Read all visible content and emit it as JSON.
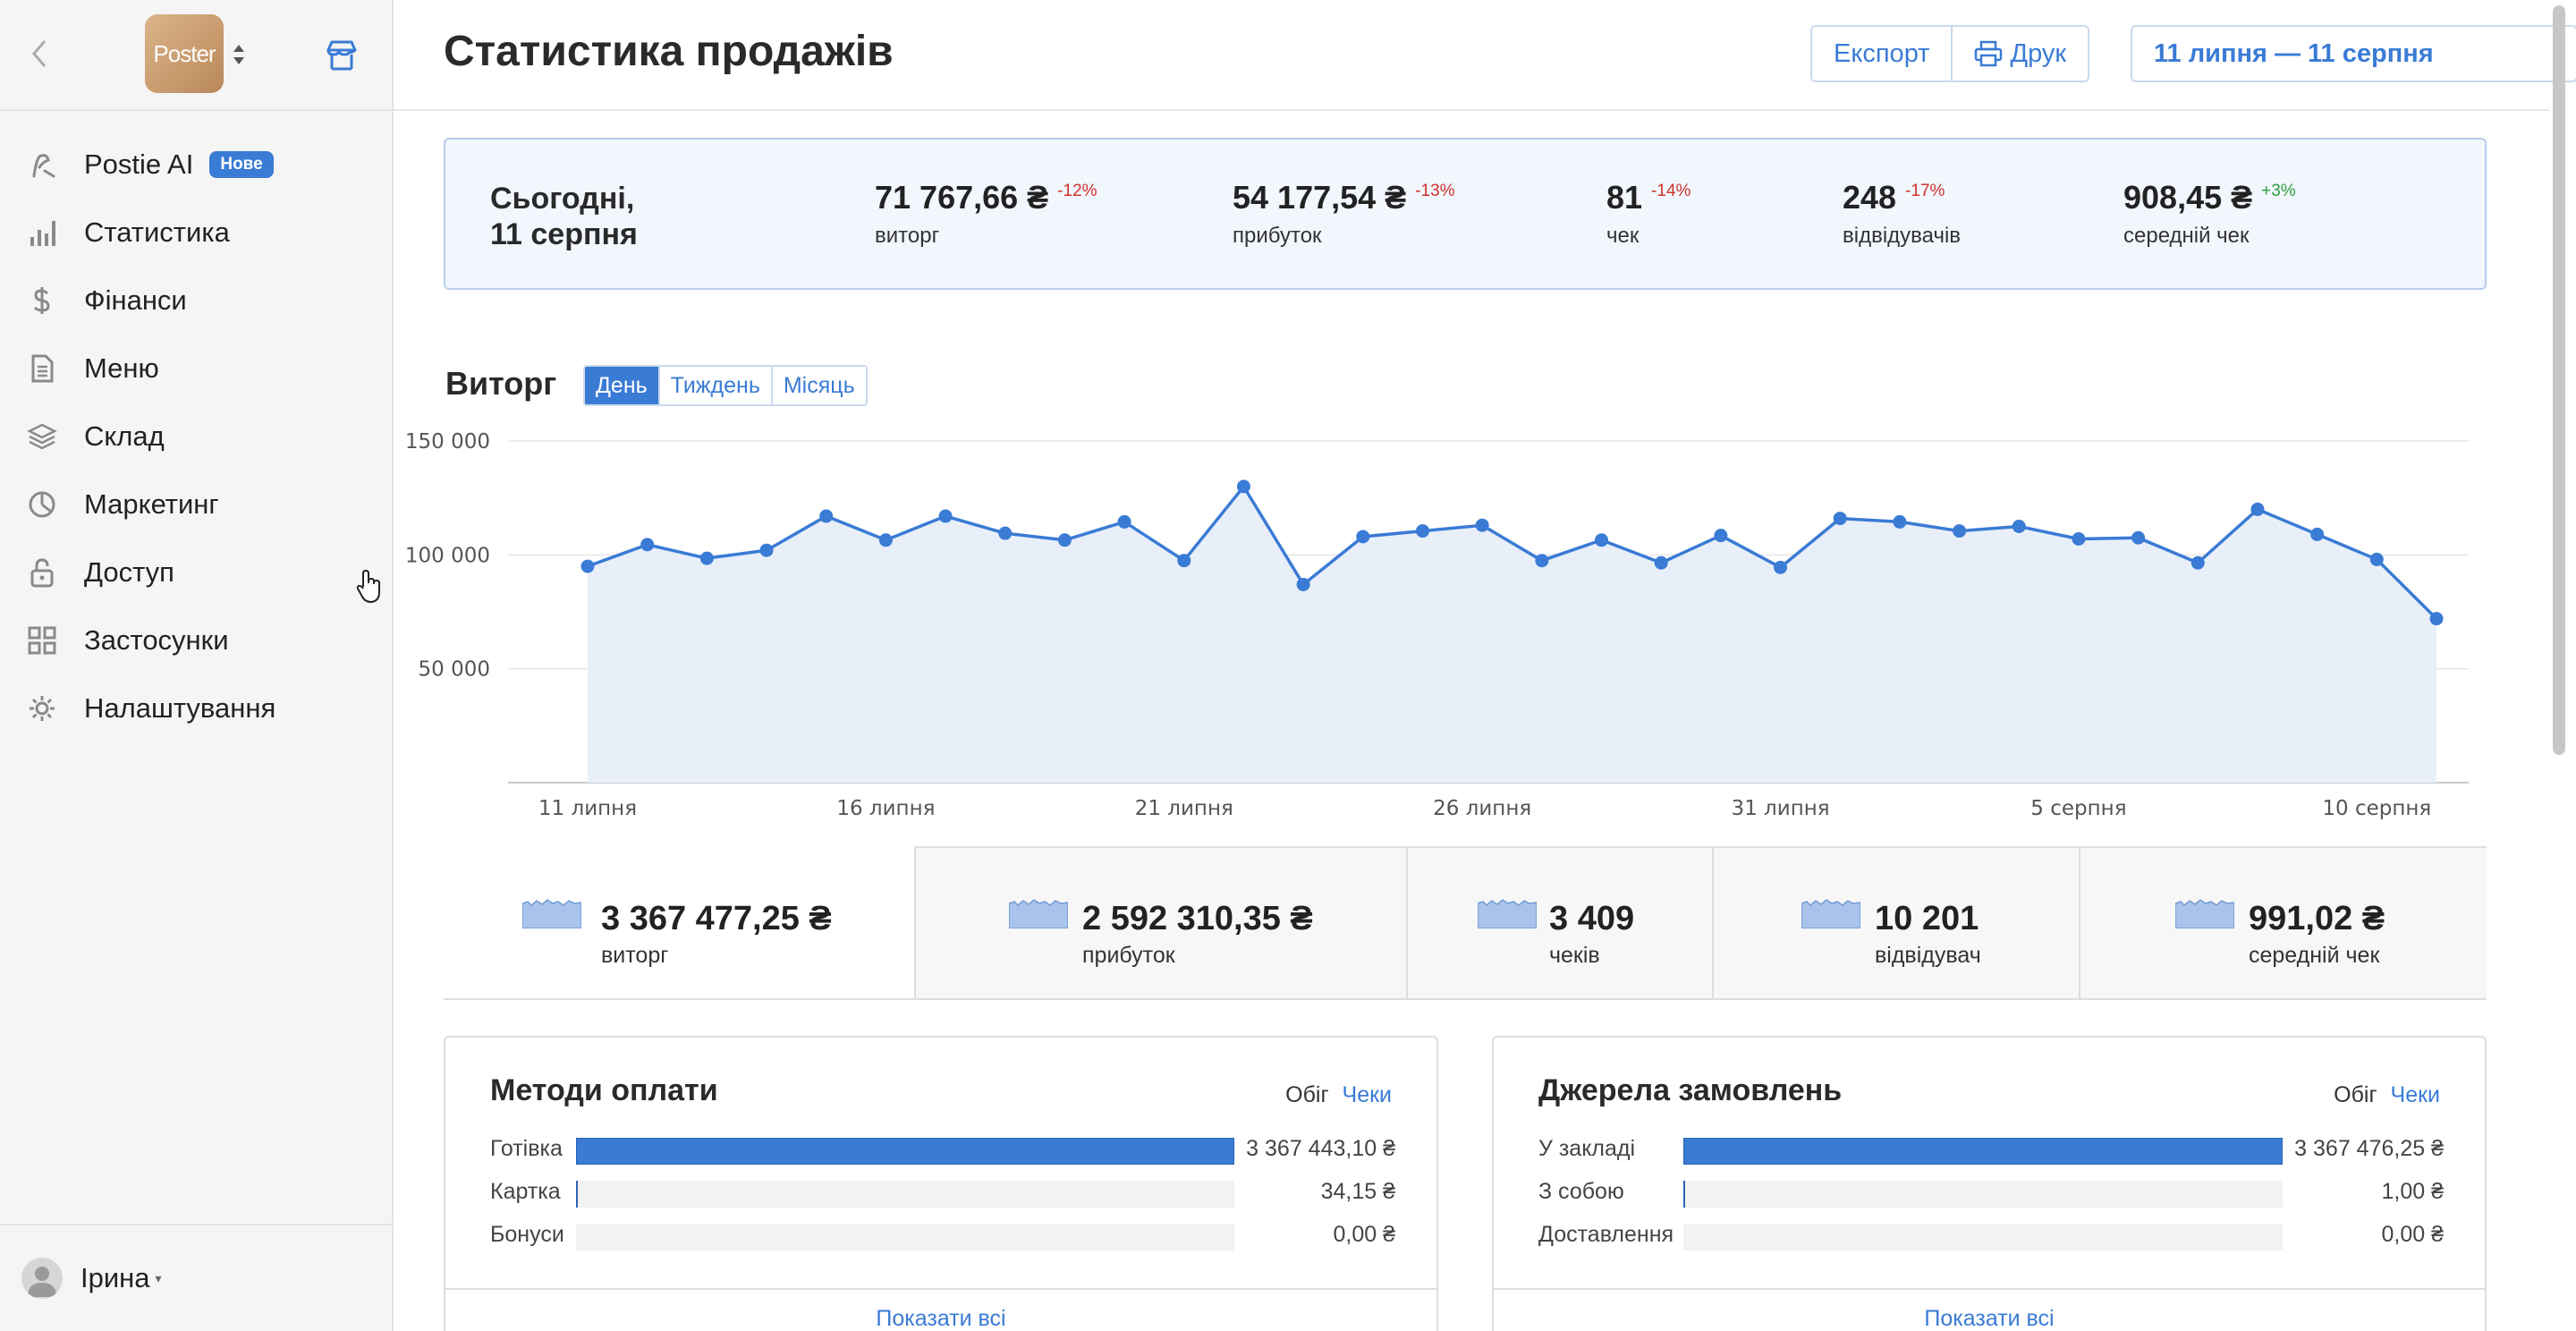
{
  "sidebar": {
    "logo_text": "Poster",
    "items": [
      {
        "label": "Postie AI",
        "icon": "postie-icon",
        "badge": "Нове"
      },
      {
        "label": "Статистика",
        "icon": "bar-chart-icon"
      },
      {
        "label": "Фінанси",
        "icon": "dollar-icon"
      },
      {
        "label": "Меню",
        "icon": "document-icon"
      },
      {
        "label": "Склад",
        "icon": "layers-icon"
      },
      {
        "label": "Маркетинг",
        "icon": "pie-icon"
      },
      {
        "label": "Доступ",
        "icon": "lock-icon"
      },
      {
        "label": "Застосунки",
        "icon": "apps-grid-icon"
      },
      {
        "label": "Налаштування",
        "icon": "gear-icon"
      }
    ],
    "user_name": "Ірина"
  },
  "header": {
    "title": "Статистика продажів",
    "export_label": "Експорт",
    "print_label": "Друк",
    "date_range": "11 липня — 11 серпня"
  },
  "today": {
    "label_line1": "Сьогодні,",
    "label_line2": "11 серпня",
    "stats": [
      {
        "value": "71 767,66 ₴",
        "delta": "-12%",
        "label": "виторг",
        "positive": false
      },
      {
        "value": "54 177,54 ₴",
        "delta": "-13%",
        "label": "прибуток",
        "positive": false
      },
      {
        "value": "81",
        "delta": "-14%",
        "label": "чек",
        "positive": false
      },
      {
        "value": "248",
        "delta": "-17%",
        "label": "відвідувачів",
        "positive": false
      },
      {
        "value": "908,45 ₴",
        "delta": "+3%",
        "label": "середній чек",
        "positive": true
      }
    ]
  },
  "revenue": {
    "title": "Виторг",
    "periods": [
      "День",
      "Тиждень",
      "Місяць"
    ],
    "active_period": "День"
  },
  "chart_data": {
    "type": "area",
    "ylim": [
      0,
      150000
    ],
    "yticks": [
      "150 000",
      "100 000",
      "50 000"
    ],
    "yticks_values": [
      150000,
      100000,
      50000
    ],
    "xtick_labels": [
      "11 липня",
      "16 липня",
      "21 липня",
      "26 липня",
      "31 липня",
      "5 серпня",
      "10 серпня"
    ],
    "xtick_indices": [
      0,
      5,
      10,
      15,
      20,
      25,
      30
    ],
    "x": [
      "11 липня",
      "12 липня",
      "13 липня",
      "14 липня",
      "15 липня",
      "16 липня",
      "17 липня",
      "18 липня",
      "19 липня",
      "20 липня",
      "21 липня",
      "22 липня",
      "23 липня",
      "24 липня",
      "25 липня",
      "26 липня",
      "27 липня",
      "28 липня",
      "29 липня",
      "30 липня",
      "31 липня",
      "1 серпня",
      "2 серпня",
      "3 серпня",
      "4 серпня",
      "5 серпня",
      "6 серпня",
      "7 серпня",
      "8 серпня",
      "9 серпня",
      "10 серпня",
      "11 серпня"
    ],
    "values": [
      95000,
      104500,
      98500,
      102000,
      117000,
      106500,
      117000,
      109500,
      106500,
      114500,
      97500,
      130000,
      87000,
      108000,
      110500,
      113000,
      97500,
      106500,
      96500,
      108500,
      94500,
      116000,
      114500,
      110500,
      112500,
      107000,
      107500,
      96500,
      120000,
      109000,
      98000,
      72000
    ],
    "color": "#3a7bd5",
    "fill": "#e8eff9"
  },
  "totals": [
    {
      "value": "3 367 477,25 ₴",
      "label": "виторг"
    },
    {
      "value": "2 592 310,35 ₴",
      "label": "прибуток"
    },
    {
      "value": "3 409",
      "label": "чеків"
    },
    {
      "value": "10 201",
      "label": "відвідувач"
    },
    {
      "value": "991,02 ₴",
      "label": "середній чек"
    }
  ],
  "payment_methods": {
    "title": "Методи оплати",
    "tab_turnover": "Обіг",
    "tab_checks": "Чеки",
    "rows": [
      {
        "label": "Готівка",
        "value": "3 367 443,10 ₴",
        "share": 0.99999
      },
      {
        "label": "Картка",
        "value": "34,15 ₴",
        "share": 1e-05
      },
      {
        "label": "Бонуси",
        "value": "0,00 ₴",
        "share": 0
      }
    ],
    "show_all": "Показати всі"
  },
  "order_sources": {
    "title": "Джерела замовлень",
    "tab_turnover": "Обіг",
    "tab_checks": "Чеки",
    "rows": [
      {
        "label": "У закладі",
        "value": "3 367 476,25 ₴",
        "share": 0.99999
      },
      {
        "label": "З собою",
        "value": "1,00 ₴",
        "share": 1e-06
      },
      {
        "label": "Доставлення",
        "value": "0,00 ₴",
        "share": 0
      }
    ],
    "show_all": "Показати всі"
  }
}
